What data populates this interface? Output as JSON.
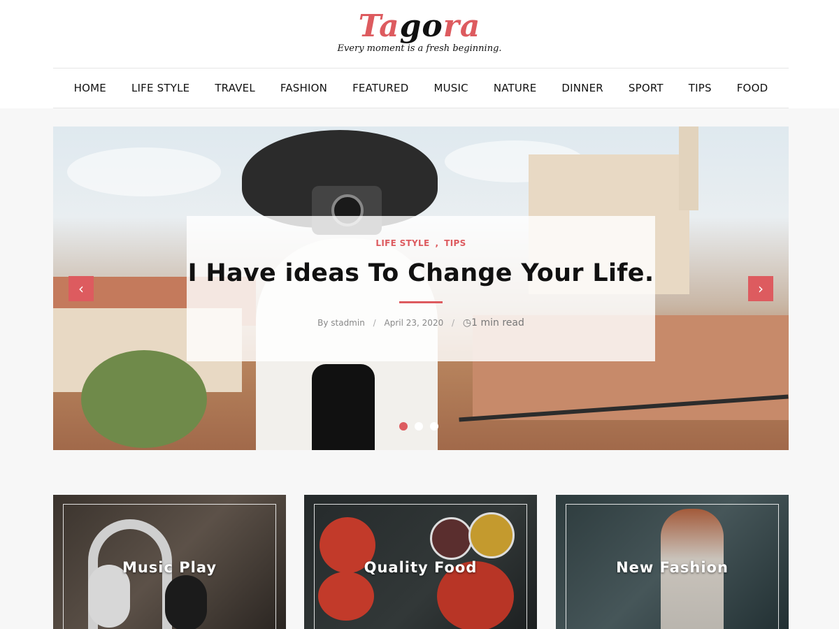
{
  "site": {
    "logo_part1": "Ta",
    "logo_part2": "go",
    "logo_part3": "ra",
    "tagline": "Every moment is a fresh beginning."
  },
  "nav": {
    "items": [
      "HOME",
      "LIFE STYLE",
      "TRAVEL",
      "FASHION",
      "FEATURED",
      "MUSIC",
      "NATURE",
      "DINNER",
      "SPORT",
      "TIPS",
      "FOOD"
    ]
  },
  "slider": {
    "categories": [
      "LIFE STYLE",
      "TIPS"
    ],
    "category_separator": ",",
    "title": "I Have ideas To Change Your Life.",
    "author": "By stadmin",
    "date": "April 23, 2020",
    "read_time": "1 min read",
    "meta_separator": "/",
    "prev_icon": "chevron-left-icon",
    "next_icon": "chevron-right-icon",
    "active_dot": 1,
    "dot_count": 3
  },
  "cards": [
    {
      "label": "Music Play"
    },
    {
      "label": "Quality Food"
    },
    {
      "label": "New Fashion"
    }
  ],
  "colors": {
    "accent": "#dd5b5f",
    "text": "#111111",
    "background": "#f7f7f7"
  }
}
